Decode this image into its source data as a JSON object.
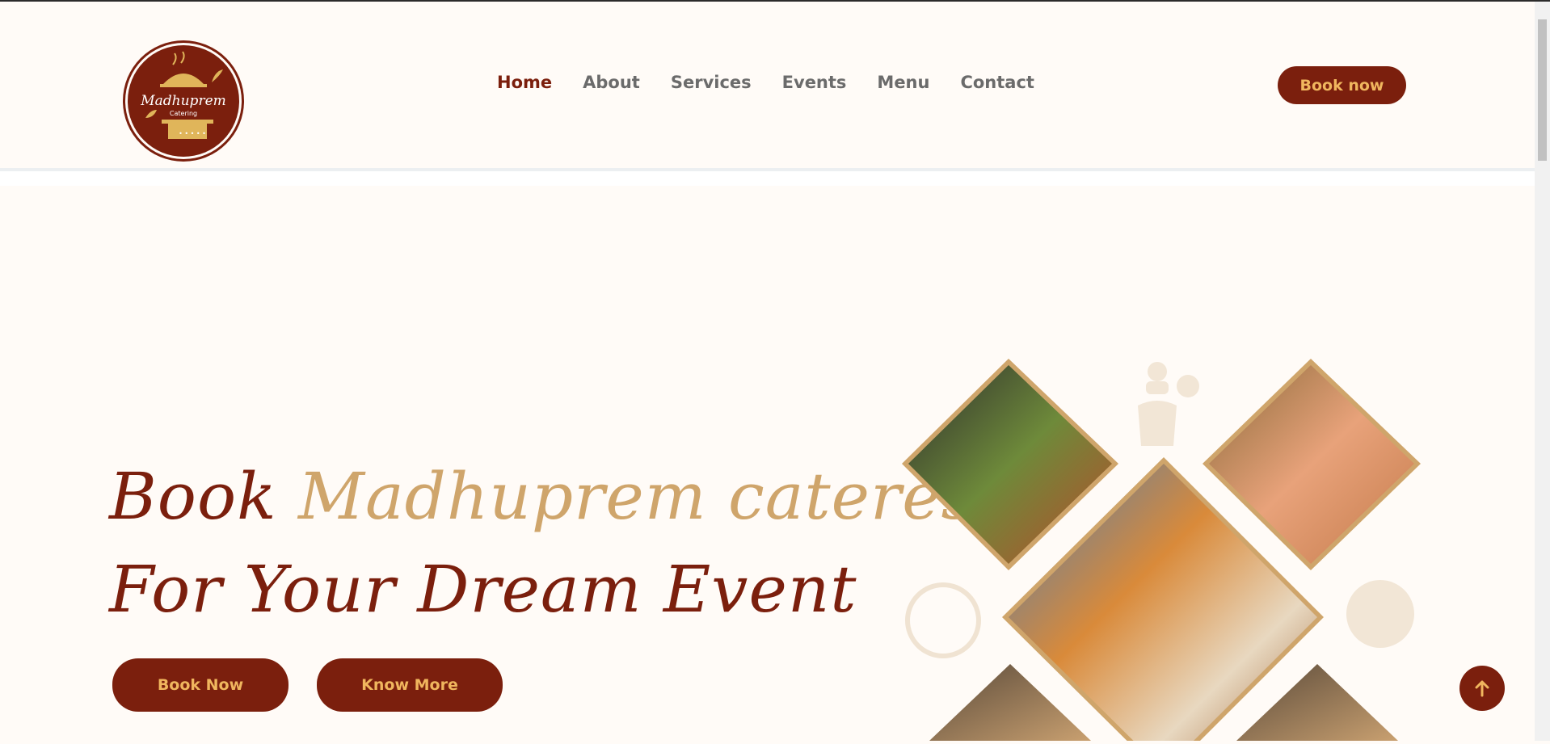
{
  "brand": {
    "name": "Madhuprem",
    "tagline": "Catering"
  },
  "nav": {
    "items": [
      {
        "label": "Home",
        "active": true
      },
      {
        "label": "About"
      },
      {
        "label": "Services"
      },
      {
        "label": "Events"
      },
      {
        "label": "Menu"
      },
      {
        "label": "Contact"
      }
    ]
  },
  "header": {
    "book_button": "Book now"
  },
  "hero": {
    "title_part1": "Book ",
    "title_accent": "Madhuprem cateres",
    "title_line2": "For Your Dream Event",
    "book_button": "Book Now",
    "more_button": "Know More"
  },
  "icons": {
    "scroll_top": "arrow-up-icon"
  },
  "colors": {
    "brand": "#7b1f0d",
    "accent": "#cfa56b",
    "button_text": "#f0b65e",
    "background": "#fffbf7"
  }
}
